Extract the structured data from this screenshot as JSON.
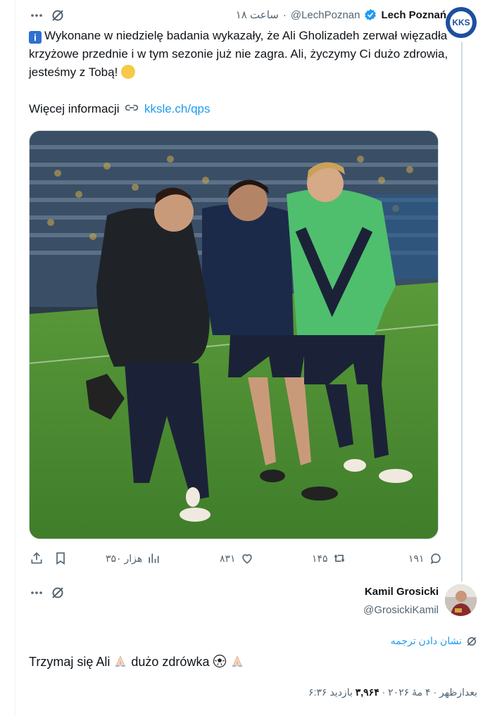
{
  "tweet": {
    "author_name": "Lech Poznań",
    "author_handle": "@LechPoznan",
    "time": "۱۸ ساعت",
    "separator": "·",
    "avatar_text": "KKS",
    "text_main": "Wykonane w niedzielę badania wykazały, że Ali Gholizadeh zerwał więzadła krzyżowe przednie i w tym sezonie już nie zagra. Ali, życzymy Ci dużo zdrowia, jesteśmy z Tobą!",
    "more_label": "Więcej informacji",
    "link_text": "kksle.ch/qps",
    "stats": {
      "replies": "۱۹۱",
      "reposts": "۱۴۵",
      "likes": "۸۳۱",
      "views": "۳۵۰ هزار"
    }
  },
  "reply": {
    "author_name": "Kamil Grosicki",
    "author_handle": "@GrosickiKamil",
    "translate_label": "نشان دادن ترجمه",
    "text_a": "Trzymaj się Ali",
    "text_b": "dużo zdrówka",
    "meta_time": "۶:۳۶ بعدازظهر · ۴ مهٔ ۲۰۲۶ ·",
    "views_count": "۳,۹۶۴",
    "views_label": "بازدید"
  },
  "colors": {
    "accent": "#1d9bf0",
    "muted": "#536471",
    "text": "#0f1419",
    "verified": "#1d9bf0"
  },
  "icons": [
    "more-icon",
    "grok-icon",
    "verified-icon",
    "info-icon",
    "link-icon",
    "reply-icon",
    "repost-icon",
    "like-icon",
    "views-icon",
    "bookmark-icon",
    "share-icon",
    "translate-icon"
  ]
}
